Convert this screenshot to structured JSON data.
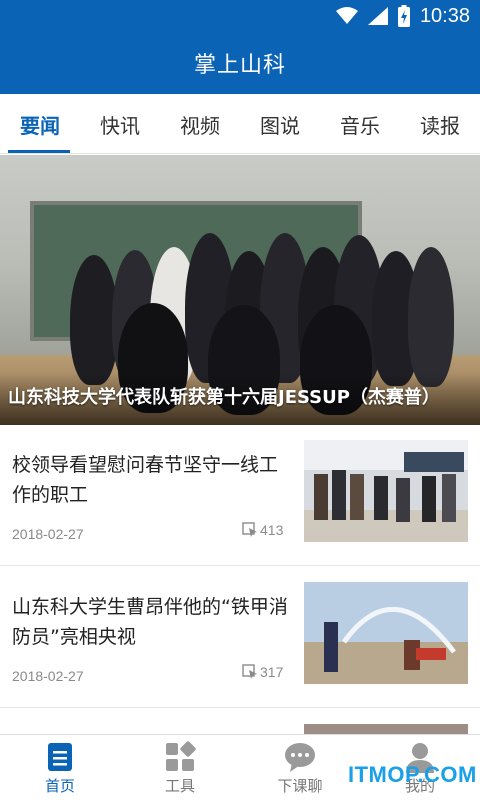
{
  "status_bar": {
    "time": "10:38"
  },
  "app_bar": {
    "title": "掌上山科"
  },
  "tabs": [
    {
      "label": "要闻",
      "active": true
    },
    {
      "label": "快讯"
    },
    {
      "label": "视频"
    },
    {
      "label": "图说"
    },
    {
      "label": "音乐"
    },
    {
      "label": "读报"
    }
  ],
  "banner": {
    "caption": "山东科技大学代表队斩获第十六届JESSUP（杰赛普）"
  },
  "news": [
    {
      "title": "校领导看望慰问春节坚守一线工作的职工",
      "date": "2018-02-27",
      "views": "413"
    },
    {
      "title": "山东科大学生曹昂伴他的“铁甲消防员”亮相央视",
      "date": "2018-02-27",
      "views": "317"
    }
  ],
  "bottom_nav": [
    {
      "label": "首页",
      "icon": "home-doc-icon",
      "active": true
    },
    {
      "label": "工具",
      "icon": "tools-grid-icon"
    },
    {
      "label": "下课聊",
      "icon": "chat-bubble-icon"
    },
    {
      "label": "我的",
      "icon": "user-icon"
    }
  ],
  "watermark": "ITMOP.COM",
  "colors": {
    "primary": "#0b63b6",
    "watermark": "#1aa0e8"
  }
}
